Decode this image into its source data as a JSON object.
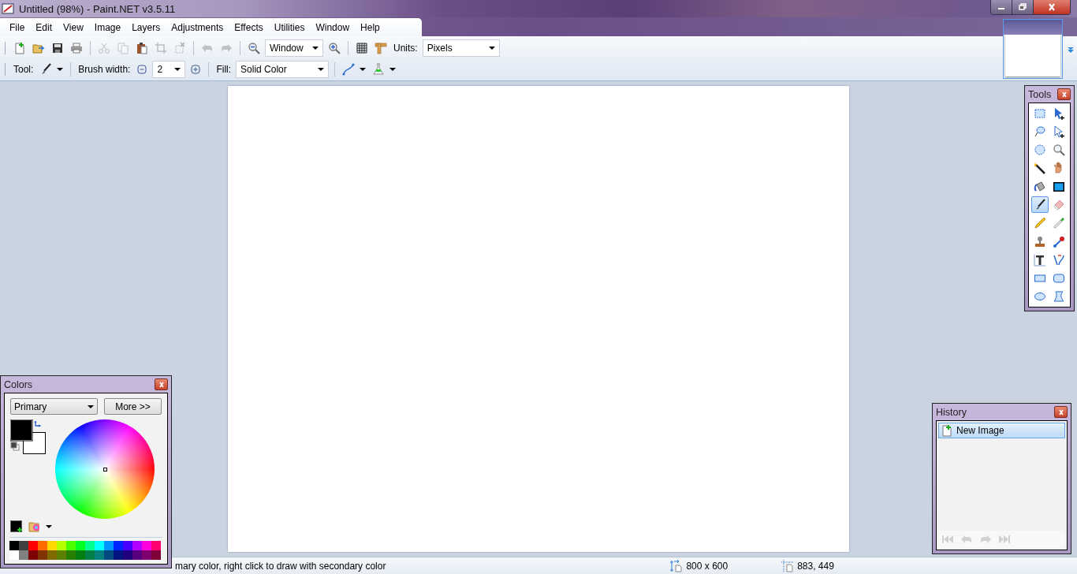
{
  "window": {
    "title": "Untitled (98%) - Paint.NET v3.5.11"
  },
  "menu": [
    "File",
    "Edit",
    "View",
    "Image",
    "Layers",
    "Adjustments",
    "Effects",
    "Utilities",
    "Window",
    "Help"
  ],
  "toolbar": {
    "file_buttons": [
      {
        "disabled": false
      },
      {
        "disabled": false
      },
      {
        "disabled": false
      },
      {
        "disabled": false
      }
    ],
    "edit_buttons": [
      {
        "disabled": true
      },
      {
        "disabled": true
      },
      {
        "disabled": false
      },
      {
        "disabled": true
      },
      {
        "disabled": true
      }
    ],
    "history_buttons": [
      {
        "disabled": true
      },
      {
        "disabled": true
      }
    ],
    "zoom": {
      "value": "Window"
    },
    "units": {
      "label": "Units:",
      "value": "Pixels"
    },
    "tool": {
      "label": "Tool:"
    },
    "brush_width": {
      "label": "Brush width:",
      "value": "2"
    },
    "fill": {
      "label": "Fill:",
      "value": "Solid Color"
    }
  },
  "tools": {
    "title": "Tools",
    "items": [
      {
        "selected": false
      },
      {
        "selected": false
      },
      {
        "selected": false
      },
      {
        "selected": false
      },
      {
        "selected": false
      },
      {
        "selected": false
      },
      {
        "selected": false
      },
      {
        "selected": false
      },
      {
        "selected": false
      },
      {
        "selected": false
      },
      {
        "selected": true
      },
      {
        "selected": false
      },
      {
        "selected": false
      },
      {
        "selected": false
      },
      {
        "selected": false
      },
      {
        "selected": false
      },
      {
        "selected": false
      },
      {
        "selected": false
      },
      {
        "selected": false
      },
      {
        "selected": false
      },
      {
        "selected": false
      },
      {
        "selected": false
      }
    ]
  },
  "colors": {
    "title": "Colors",
    "mode": "Primary",
    "more": "More >>",
    "palette": [
      {
        "color": "#000000"
      },
      {
        "color": "#404040"
      },
      {
        "color": "#ff0000"
      },
      {
        "color": "#ff6a00"
      },
      {
        "color": "#ffd800"
      },
      {
        "color": "#b6ff00"
      },
      {
        "color": "#4cff00"
      },
      {
        "color": "#00ff21"
      },
      {
        "color": "#00ff90"
      },
      {
        "color": "#00ffff"
      },
      {
        "color": "#0094ff"
      },
      {
        "color": "#0026ff"
      },
      {
        "color": "#4800ff"
      },
      {
        "color": "#b200ff"
      },
      {
        "color": "#ff00dc"
      },
      {
        "color": "#ff006e"
      },
      {
        "color": "#ffffff"
      },
      {
        "color": "#808080"
      },
      {
        "color": "#7f0000"
      },
      {
        "color": "#7f3300"
      },
      {
        "color": "#7f6a00"
      },
      {
        "color": "#5b7f00"
      },
      {
        "color": "#267f00"
      },
      {
        "color": "#007f0e"
      },
      {
        "color": "#007f46"
      },
      {
        "color": "#007f7f"
      },
      {
        "color": "#004a7f"
      },
      {
        "color": "#00137f"
      },
      {
        "color": "#21007f"
      },
      {
        "color": "#57007f"
      },
      {
        "color": "#7f006e"
      },
      {
        "color": "#7f0037"
      }
    ]
  },
  "history": {
    "title": "History",
    "items": [
      {
        "label": "New Image",
        "selected": true
      }
    ],
    "nav": [
      {
        "disabled": true
      },
      {
        "disabled": true
      },
      {
        "disabled": true
      },
      {
        "disabled": true
      }
    ]
  },
  "status_bar": {
    "hint": "mary color, right click to draw with secondary color",
    "size": "800 x 600",
    "cursor": "883, 449"
  }
}
